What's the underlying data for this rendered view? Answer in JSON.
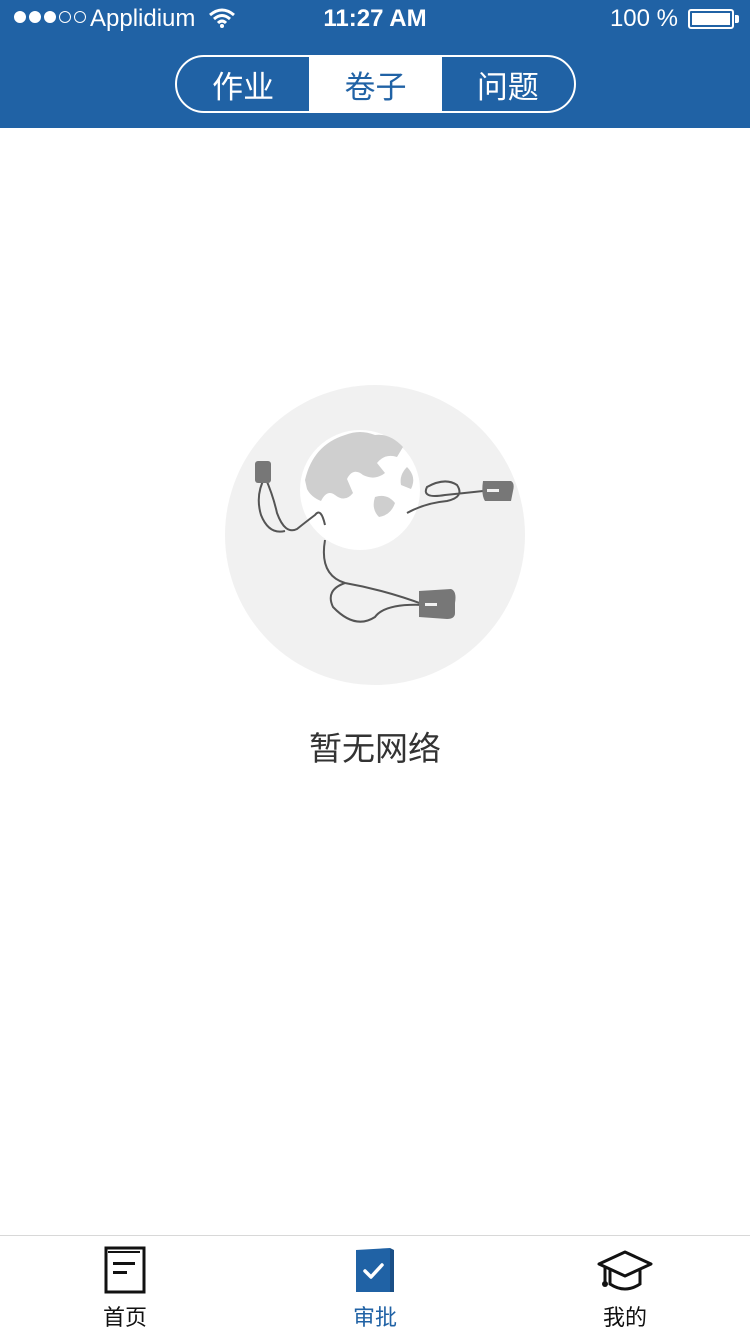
{
  "status_bar": {
    "carrier": "Applidium",
    "time": "11:27 AM",
    "battery": "100 %"
  },
  "segmented_control": {
    "tabs": [
      {
        "label": "作业",
        "active": false
      },
      {
        "label": "卷子",
        "active": true
      },
      {
        "label": "问题",
        "active": false
      }
    ]
  },
  "empty_state": {
    "icon": "no-network-globe-icon",
    "message": "暂无网络"
  },
  "tab_bar": {
    "items": [
      {
        "label": "首页",
        "icon": "book-icon",
        "active": false
      },
      {
        "label": "审批",
        "icon": "checked-book-icon",
        "active": true
      },
      {
        "label": "我的",
        "icon": "graduation-cap-icon",
        "active": false
      }
    ]
  },
  "colors": {
    "primary": "#2062a5",
    "background": "#ffffff",
    "illustration_bg": "#f1f1f1",
    "text": "#333333"
  }
}
